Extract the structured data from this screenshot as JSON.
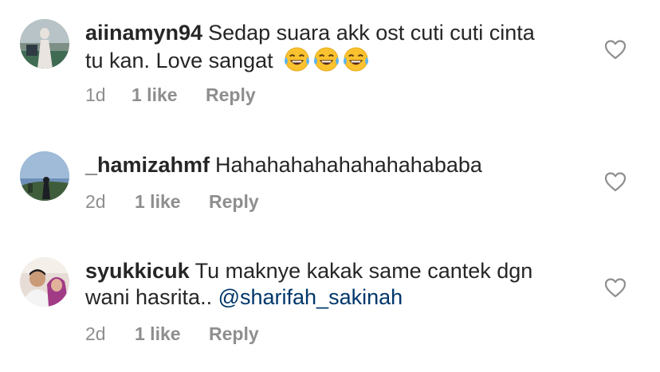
{
  "comments": [
    {
      "username": "aiinamyn94",
      "text_line1": "Sedap suara akk ost cuti cuti cinta",
      "text_line2": "tu kan. Love sangat",
      "emojis": [
        "face-with-tears-of-joy",
        "face-with-tears-of-joy",
        "face-with-tears-of-joy"
      ],
      "time": "1d",
      "likes": "1 like",
      "reply": "Reply"
    },
    {
      "username": "_hamizahmf",
      "text_line1": "Hahahahahahahahahababa",
      "time": "2d",
      "likes": "1 like",
      "reply": "Reply"
    },
    {
      "username": "syukkicuk",
      "text_line1": "Tu maknye kakak same cantek dgn",
      "text_line2": "wani hasrita..",
      "mention": "@sharifah_sakinah",
      "time": "2d",
      "likes": "1 like",
      "reply": "Reply"
    }
  ],
  "icons": {
    "like": "heart-outline-icon"
  },
  "colors": {
    "text": "#262626",
    "meta": "#8e8e8e",
    "mention": "#00376b"
  }
}
